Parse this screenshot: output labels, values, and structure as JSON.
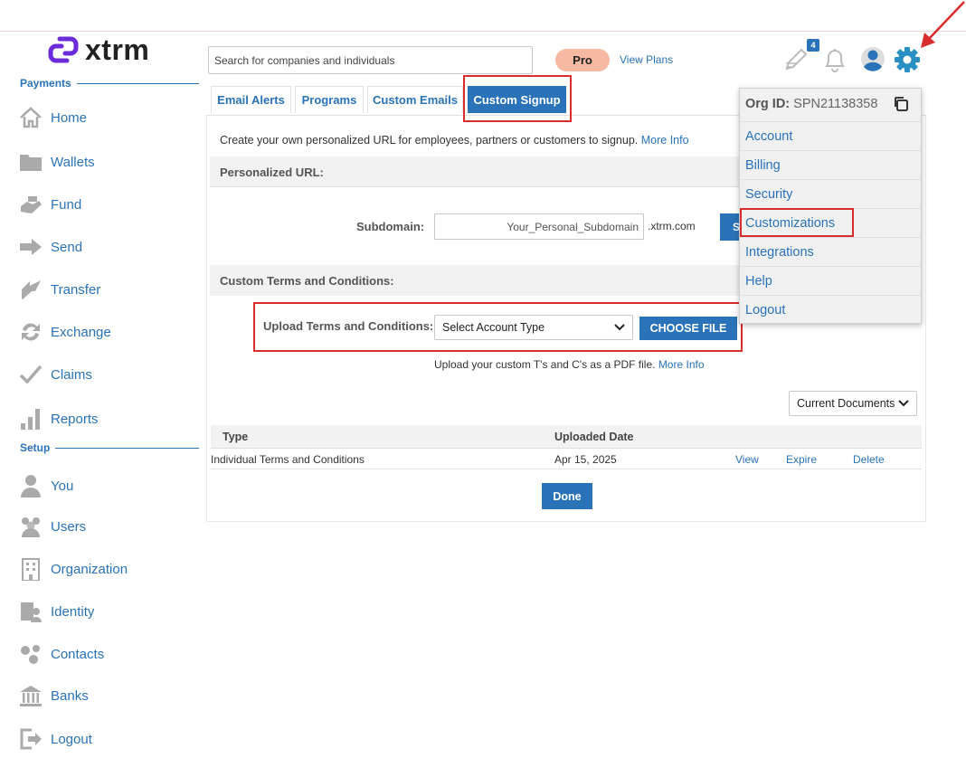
{
  "app": {
    "brand": "xtrm"
  },
  "header": {
    "search_placeholder": "Search for companies and individuals",
    "plan_badge": "Pro",
    "view_plans": "View Plans",
    "notif_count": "4"
  },
  "sidebar": {
    "payments_label": "Payments",
    "setup_label": "Setup",
    "payments": [
      {
        "label": "Home"
      },
      {
        "label": "Wallets"
      },
      {
        "label": "Fund"
      },
      {
        "label": "Send"
      },
      {
        "label": "Transfer"
      },
      {
        "label": "Exchange"
      },
      {
        "label": "Claims"
      },
      {
        "label": "Reports"
      }
    ],
    "setup": [
      {
        "label": "You"
      },
      {
        "label": "Users"
      },
      {
        "label": "Organization"
      },
      {
        "label": "Identity"
      },
      {
        "label": "Contacts"
      },
      {
        "label": "Banks"
      },
      {
        "label": "Logout"
      }
    ]
  },
  "tabs": [
    {
      "label": "Email Alerts"
    },
    {
      "label": "Programs"
    },
    {
      "label": "Custom Emails"
    },
    {
      "label": "Custom Signup",
      "active": true
    }
  ],
  "content": {
    "description": "Create your own personalized URL for employees, partners or customers to signup.",
    "more_info": "More Info",
    "personalized_url_heading": "Personalized URL:",
    "subdomain_label": "Subdomain:",
    "subdomain_placeholder": "Your_Personal_Subdomain",
    "subdomain_suffix": ".xtrm.com",
    "save_button": "Save",
    "terms_heading": "Custom Terms and Conditions:",
    "upload_label": "Upload Terms and Conditions:",
    "account_type_select": "Select Account Type",
    "choose_file": "CHOOSE FILE",
    "upload_note": "Upload your custom T's and C's as a PDF file.",
    "upload_more_info": "More Info",
    "docs_filter": "Current Documents",
    "table": {
      "columns": [
        "Type",
        "Uploaded Date"
      ],
      "rows": [
        {
          "type": "Individual Terms and Conditions",
          "date": "Apr 15, 2025",
          "actions": [
            "View",
            "Expire",
            "Delete"
          ]
        }
      ]
    },
    "done_button": "Done"
  },
  "dropdown": {
    "org_label": "Org ID:",
    "org_id": "SPN21138358",
    "items": [
      {
        "label": "Account"
      },
      {
        "label": "Billing"
      },
      {
        "label": "Security"
      },
      {
        "label": "Customizations"
      },
      {
        "label": "Integrations"
      },
      {
        "label": "Help"
      },
      {
        "label": "Logout"
      }
    ]
  },
  "colors": {
    "accent": "#2a73b8",
    "highlight": "#d92d2d",
    "pro_badge": "#f6b9a2",
    "brand_purple": "#6c2bd9"
  }
}
